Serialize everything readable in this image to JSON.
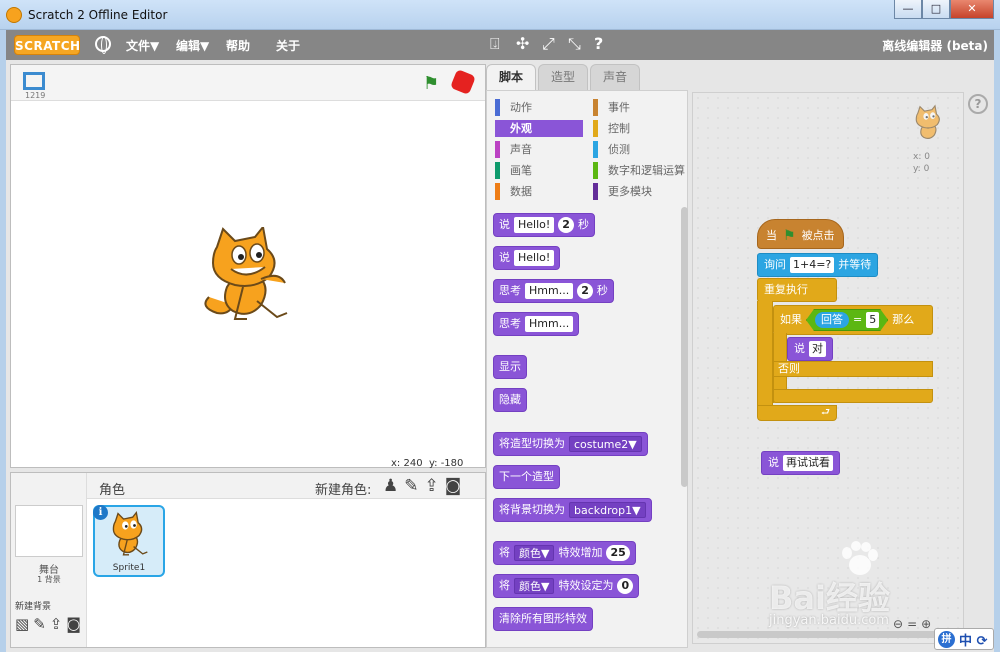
{
  "window": {
    "title": "Scratch 2 Offline Editor",
    "buttons": {
      "minimize": "—",
      "maximize": "□",
      "close": "✕"
    }
  },
  "menubar": {
    "logo": "SCRATCH",
    "menus": [
      "文件▼",
      "编辑▼",
      "帮助",
      "关于"
    ],
    "tools": [
      "⍗",
      "✣",
      "⤢",
      "⤡",
      "?"
    ],
    "offline_label": "离线编辑器 (beta)"
  },
  "stage": {
    "version": "1219",
    "coords": {
      "x_label": "x:",
      "x_value": "240",
      "y_label": "y:",
      "y_value": "-180"
    }
  },
  "sprites": {
    "header_title": "角色",
    "new_sprite": "新建角色:",
    "stage_label": "舞台",
    "stage_bg_count": "1 背景",
    "new_backdrop": "新建背景",
    "items": [
      {
        "name": "Sprite1"
      }
    ]
  },
  "tabs": [
    "脚本",
    "造型",
    "声音"
  ],
  "palette": {
    "categories_left": [
      "动作",
      "外观",
      "声音",
      "画笔",
      "数据"
    ],
    "categories_right": [
      "事件",
      "控制",
      "侦测",
      "数字和逻辑运算",
      "更多模块"
    ],
    "category_colors": {
      "动作": "#4a6cd4",
      "外观": "#8a55d7",
      "声音": "#bb42c3",
      "画笔": "#0e9a6c",
      "数据": "#ee7d16",
      "事件": "#c88330",
      "控制": "#e1a91a",
      "侦测": "#2ca5e2",
      "数字和逻辑运算": "#5cb712",
      "更多模块": "#632d99"
    },
    "active_category": "外观",
    "blocks": {
      "say_secs": {
        "label": "说",
        "text": "Hello!",
        "secs": "2",
        "unit": "秒"
      },
      "say": {
        "label": "说",
        "text": "Hello!"
      },
      "think_secs": {
        "label": "思考",
        "text": "Hmm...",
        "secs": "2",
        "unit": "秒"
      },
      "think": {
        "label": "思考",
        "text": "Hmm..."
      },
      "show": "显示",
      "hide": "隐藏",
      "switch_costume": {
        "label": "将造型切换为",
        "value": "costume2▼"
      },
      "next_costume": "下一个造型",
      "switch_backdrop": {
        "label": "将背景切换为",
        "value": "backdrop1▼"
      },
      "change_effect": {
        "label": "将",
        "effect": "颜色▼",
        "mid": "特效增加",
        "value": "25"
      },
      "set_effect": {
        "label": "将",
        "effect": "颜色▼",
        "mid": "特效设定为",
        "value": "0"
      },
      "clear_effects": "清除所有图形特效"
    }
  },
  "scripts": {
    "sprite_xy": {
      "x": "x: 0",
      "y": "y: 0"
    },
    "when_flag": {
      "prefix": "当",
      "suffix": "被点击"
    },
    "ask": {
      "label": "询问",
      "question": "1+4=?",
      "suffix": "并等待"
    },
    "forever": "重复执行",
    "if": {
      "label": "如果",
      "answer": "回答",
      "op": "=",
      "value": "5",
      "suffix": "那么"
    },
    "say_correct": {
      "label": "说",
      "text": "对"
    },
    "else": "否则",
    "forever_end": "⮐",
    "say_retry": {
      "label": "说",
      "text": "再试试看"
    },
    "help": "?"
  },
  "watermark": {
    "text": "Bai经验",
    "url": "jingyan.baidu.com"
  },
  "ime": {
    "logo": "拼",
    "label": "中 ⟳"
  }
}
